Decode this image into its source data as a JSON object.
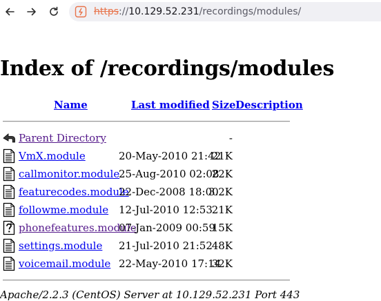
{
  "browser": {
    "url_scheme": "https",
    "url_sep": "://",
    "url_host": "10.129.52.231",
    "url_path": "/recordings/modules/"
  },
  "page": {
    "title": "Index of /recordings/modules",
    "columns": {
      "name": "Name",
      "last_modified": "Last modified",
      "size": "Size",
      "description": "Description"
    },
    "entries": [
      {
        "name": "Parent Directory",
        "date": "",
        "size": "-",
        "icon": "back-icon",
        "visited": true
      },
      {
        "name": "VmX.module",
        "date": "20-May-2010 21:42",
        "size": "21K",
        "icon": "text-file-icon",
        "visited": false
      },
      {
        "name": "callmonitor.module",
        "date": "25-Aug-2010 02:08",
        "size": "22K",
        "icon": "text-file-icon",
        "visited": false
      },
      {
        "name": "featurecodes.module",
        "date": "22-Dec-2008 18:00",
        "size": "3.2K",
        "icon": "text-file-icon",
        "visited": false
      },
      {
        "name": "followme.module",
        "date": "12-Jul-2010 12:53",
        "size": "21K",
        "icon": "text-file-icon",
        "visited": false
      },
      {
        "name": "phonefeatures.module",
        "date": "07-Jan-2009 00:59",
        "size": "15K",
        "icon": "unknown-file-icon",
        "visited": true
      },
      {
        "name": "settings.module",
        "date": "21-Jul-2010 21:52",
        "size": "48K",
        "icon": "text-file-icon",
        "visited": false
      },
      {
        "name": "voicemail.module",
        "date": "22-May-2010 17:14",
        "size": "32K",
        "icon": "text-file-icon",
        "visited": false
      }
    ],
    "footer": "Apache/2.2.3 (CentOS) Server at 10.129.52.231 Port 443"
  }
}
